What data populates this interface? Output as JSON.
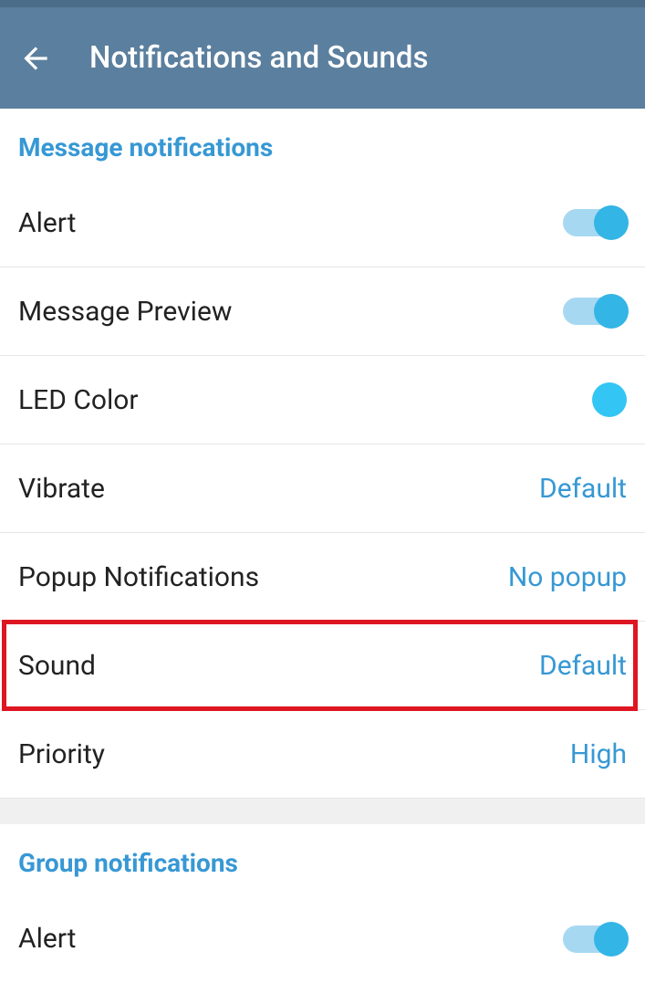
{
  "header": {
    "title": "Notifications and Sounds"
  },
  "sections": {
    "message": {
      "header": "Message notifications",
      "alert": {
        "label": "Alert",
        "enabled": true
      },
      "preview": {
        "label": "Message Preview",
        "enabled": true
      },
      "led": {
        "label": "LED Color",
        "color": "#33c6f4"
      },
      "vibrate": {
        "label": "Vibrate",
        "value": "Default"
      },
      "popup": {
        "label": "Popup Notifications",
        "value": "No popup"
      },
      "sound": {
        "label": "Sound",
        "value": "Default"
      },
      "priority": {
        "label": "Priority",
        "value": "High"
      }
    },
    "group": {
      "header": "Group notifications",
      "alert": {
        "label": "Alert",
        "enabled": true
      }
    }
  }
}
